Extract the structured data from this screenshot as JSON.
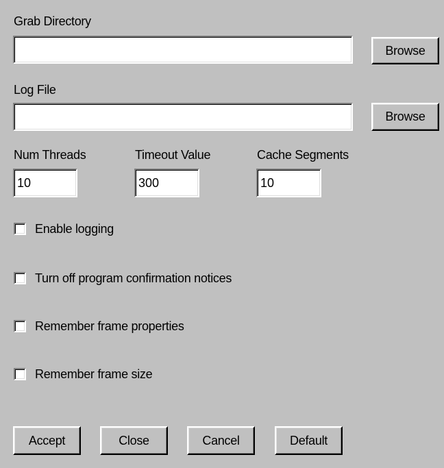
{
  "grab_directory": {
    "label": "Grab Directory",
    "value": "",
    "browse_label": "Browse"
  },
  "log_file": {
    "label": "Log File",
    "value": "",
    "browse_label": "Browse"
  },
  "num_threads": {
    "label": "Num Threads",
    "value": "10"
  },
  "timeout_value": {
    "label": "Timeout Value",
    "value": "300"
  },
  "cache_segments": {
    "label": "Cache Segments",
    "value": "10"
  },
  "options": [
    {
      "label": "Enable logging",
      "checked": false
    },
    {
      "label": "Turn off program confirmation notices",
      "checked": false
    },
    {
      "label": "Remember frame properties",
      "checked": false
    },
    {
      "label": "Remember frame size",
      "checked": false
    }
  ],
  "buttons": {
    "accept": "Accept",
    "close": "Close",
    "cancel": "Cancel",
    "default": "Default"
  },
  "colors": {
    "face": "#c0c0c0",
    "field": "#ffffff"
  }
}
